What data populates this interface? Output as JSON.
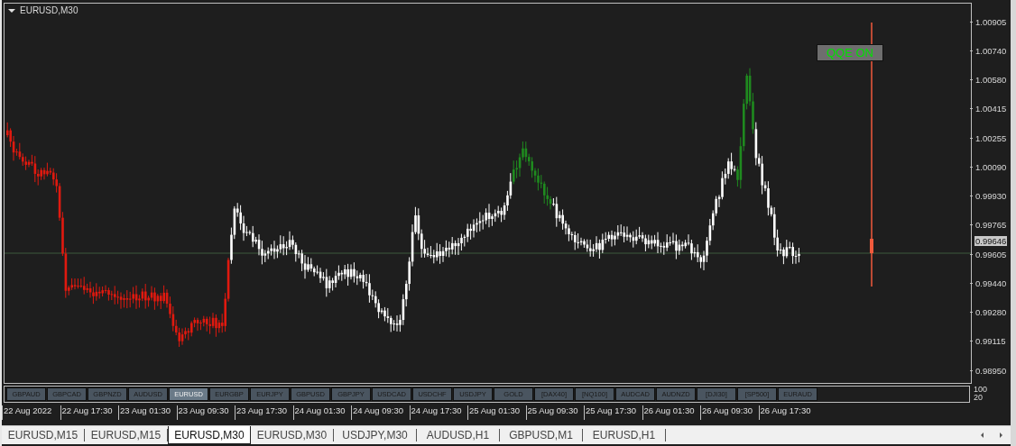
{
  "chart_window": {
    "title": "EURUSD,M30",
    "indicator_button": "QQE ON"
  },
  "price_axis": {
    "labels": [
      "1.00905",
      "1.00740",
      "1.00580",
      "1.00415",
      "1.00255",
      "1.00090",
      "0.99930",
      "0.99765",
      "0.99605",
      "0.99440",
      "0.99280",
      "0.99115",
      "0.98950"
    ],
    "current_price": "0.99646"
  },
  "symbol_buttons": [
    {
      "label": "GBPAUD",
      "selected": false
    },
    {
      "label": "GBPCAD",
      "selected": false
    },
    {
      "label": "GBPNZD",
      "selected": false
    },
    {
      "label": "AUDUSD",
      "selected": false
    },
    {
      "label": "EURUSD",
      "selected": true
    },
    {
      "label": "EURGBP",
      "selected": false
    },
    {
      "label": "EURJPY",
      "selected": false
    },
    {
      "label": "GBPUSD",
      "selected": false
    },
    {
      "label": "GBPJPY",
      "selected": false
    },
    {
      "label": "USDCAD",
      "selected": false
    },
    {
      "label": "USDCHF",
      "selected": false
    },
    {
      "label": "USDJPY",
      "selected": false
    },
    {
      "label": "GOLD",
      "selected": false
    },
    {
      "label": "[DAX40]",
      "selected": false
    },
    {
      "label": "[NQ100]",
      "selected": false
    },
    {
      "label": "AUDCAD",
      "selected": false
    },
    {
      "label": "AUDNZD",
      "selected": false
    },
    {
      "label": "[DJI30]",
      "selected": false
    },
    {
      "label": "[SP500]",
      "selected": false
    },
    {
      "label": "EURAUD",
      "selected": false
    }
  ],
  "indicator_axis": [
    "100",
    "20"
  ],
  "time_axis": [
    "22 Aug 2022",
    "22 Aug 17:30",
    "23 Aug 01:30",
    "23 Aug 09:30",
    "23 Aug 17:30",
    "24 Aug 01:30",
    "24 Aug 09:30",
    "24 Aug 17:30",
    "25 Aug 01:30",
    "25 Aug 09:30",
    "25 Aug 17:30",
    "26 Aug 01:30",
    "26 Aug 09:30",
    "26 Aug 17:30"
  ],
  "tabs": [
    {
      "label": "EURUSD,M15",
      "selected": false
    },
    {
      "label": "EURUSD,M15",
      "selected": false
    },
    {
      "label": "EURUSD,M30",
      "selected": true
    },
    {
      "label": "EURUSD,M30",
      "selected": false
    },
    {
      "label": "USDJPY,M30",
      "selected": false
    },
    {
      "label": "AUDUSD,H1",
      "selected": false
    },
    {
      "label": "GBPUSD,M1",
      "selected": false
    },
    {
      "label": "EURUSD,H1",
      "selected": false
    }
  ]
}
